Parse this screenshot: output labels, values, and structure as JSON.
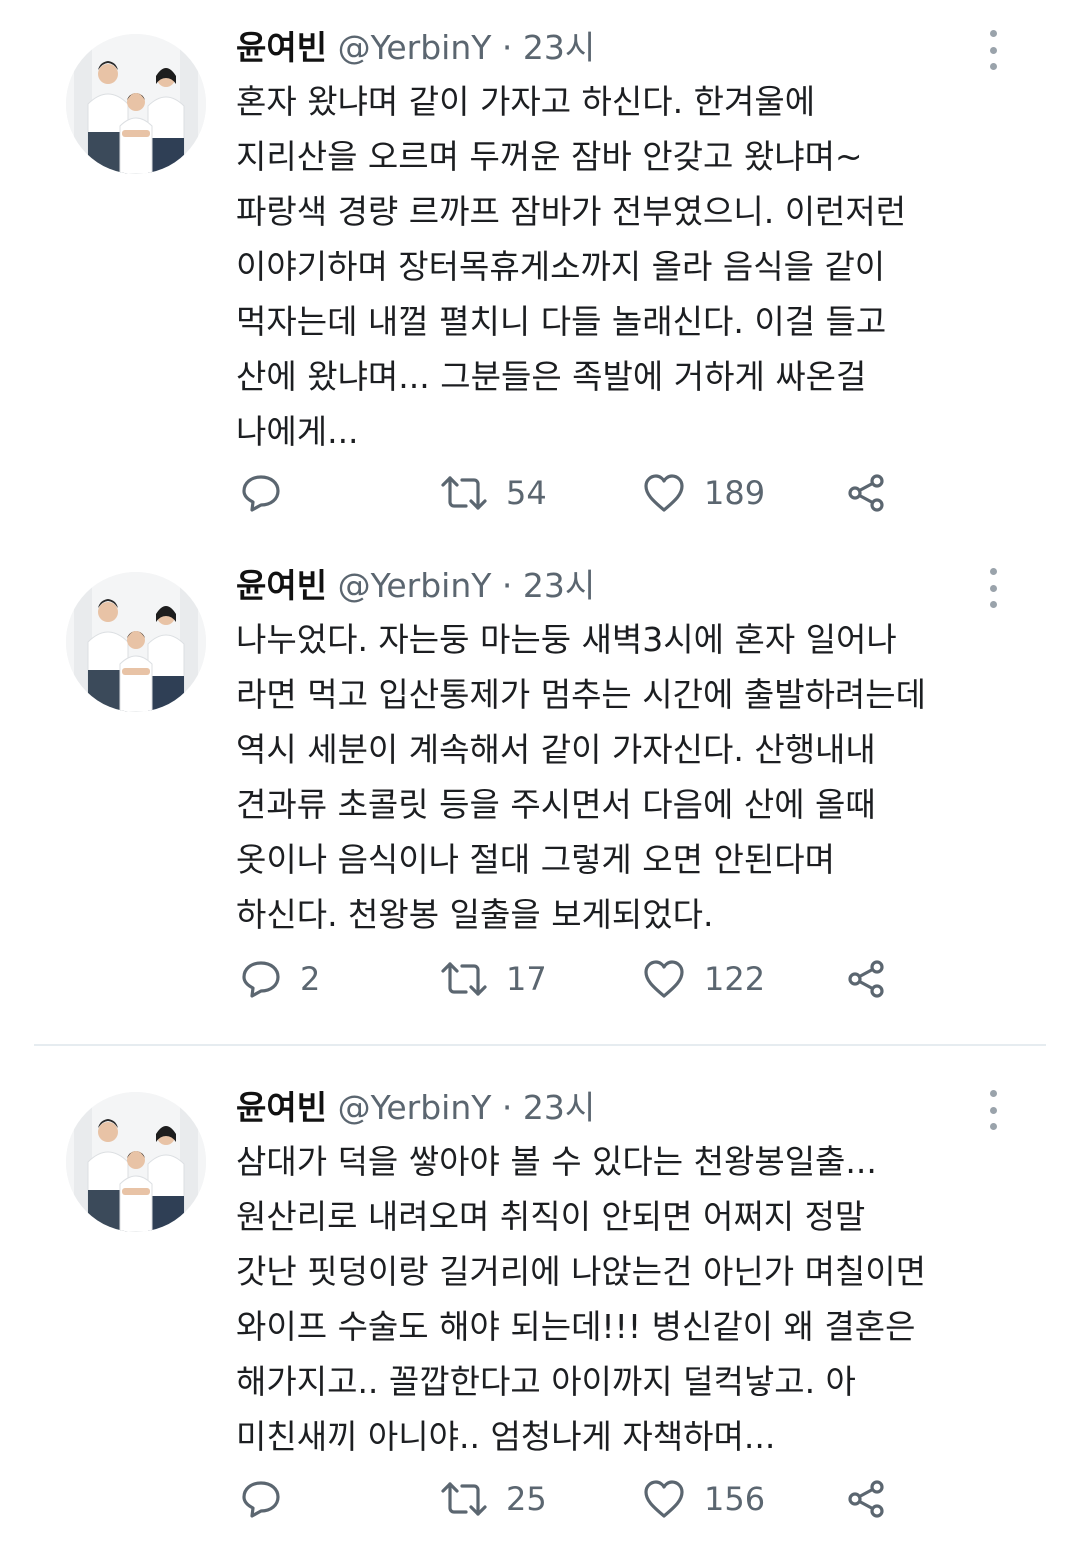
{
  "tweets": [
    {
      "name": "윤여빈",
      "meta": "@YerbinY · 23시",
      "lines": [
        "혼자 왔냐며 같이 가자고 하신다. 한겨울에",
        "지리산을 오르며 두꺼운 잠바 안갖고 왔냐며~",
        "파랑색 경량 르까프 잠바가 전부였으니. 이런저런",
        "이야기하며 장터목휴게소까지 올라 음식을 같이",
        "먹자는데 내껄 펼치니 다들 놀래신다. 이걸 들고",
        "산에 왔냐며... 그분들은 족발에 거하게 싸온걸",
        "나에게..."
      ],
      "reply_count": "",
      "retweet_count": "54",
      "like_count": "189"
    },
    {
      "name": "윤여빈",
      "meta": "@YerbinY · 23시",
      "lines": [
        "나누었다. 자는둥 마는둥 새벽3시에 혼자 일어나",
        "라면 먹고 입산통제가 멈추는 시간에 출발하려는데",
        "역시 세분이 계속해서 같이 가자신다. 산행내내",
        "견과류 초콜릿 등을 주시면서 다음에 산에 올때",
        "옷이나 음식이나 절대 그렇게 오면 안된다며",
        "하신다. 천왕봉 일출을 보게되었다."
      ],
      "reply_count": "2",
      "retweet_count": "17",
      "like_count": "122"
    },
    {
      "name": "윤여빈",
      "meta": "@YerbinY · 23시",
      "lines": [
        "삼대가 덕을 쌓아야 볼 수 있다는 천왕봉일출...",
        "원산리로 내려오며 취직이 안되면 어쩌지 정말",
        "갓난 핏덩이랑 길거리에 나앉는건 아닌가 며칠이면",
        "와이프 수술도 해야 되는데!!! 병신같이 왜 결혼은",
        "해가지고.. 꼴깝한다고 아이까지 덜컥낳고. 아",
        "미친새끼 아니야.. 엄청나게 자책하며..."
      ],
      "reply_count": "",
      "retweet_count": "25",
      "like_count": "156"
    }
  ],
  "icons": {
    "reply": "speech-bubble-icon",
    "retweet": "retweet-arrows-icon",
    "like": "heart-outline-icon",
    "share": "share-nodes-icon",
    "more": "vertical-dots-icon"
  },
  "colors": {
    "text": "#1c1e21",
    "muted": "#5b6670",
    "icon": "#5b6670",
    "divider": "#e6ecf0"
  }
}
